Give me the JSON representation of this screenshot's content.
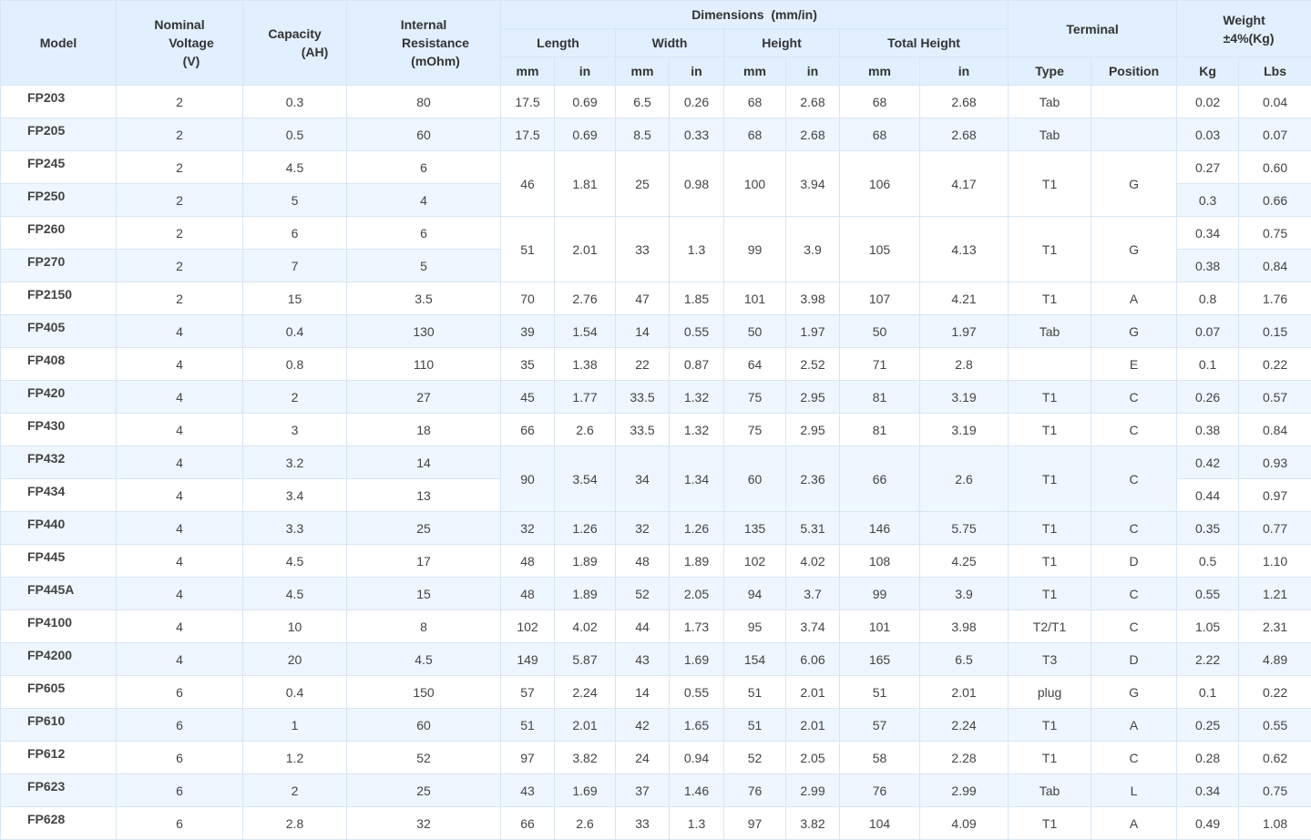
{
  "headers": {
    "model": "Model",
    "voltage": [
      "Nominal",
      "Voltage",
      "(V)"
    ],
    "capacity": [
      "Capacity",
      "(AH)"
    ],
    "resistance": [
      "Internal",
      "Resistance",
      "(mOhm)"
    ],
    "dimensions": "Dimensions  (mm/in)",
    "length": "Length",
    "width": "Width",
    "height": "Height",
    "total_height": "Total Height",
    "terminal": "Terminal",
    "weight": [
      "Weight",
      "±4%(Kg)"
    ],
    "mm": "mm",
    "in": "in",
    "type": "Type",
    "position": "Position",
    "kg": "Kg",
    "lbs": "Lbs"
  },
  "rows": [
    {
      "model": "FP203",
      "v": "2",
      "ah": "0.3",
      "r": "80",
      "dims": [
        "17.5",
        "0.69",
        "6.5",
        "0.26",
        "68",
        "2.68",
        "68",
        "2.68"
      ],
      "type": "Tab",
      "pos": "",
      "kg": "0.02",
      "lbs": "0.04"
    },
    {
      "model": "FP205",
      "v": "2",
      "ah": "0.5",
      "r": "60",
      "dims": [
        "17.5",
        "0.69",
        "8.5",
        "0.33",
        "68",
        "2.68",
        "68",
        "2.68"
      ],
      "type": "Tab",
      "pos": "",
      "kg": "0.03",
      "lbs": "0.07"
    },
    {
      "model": "FP245",
      "v": "2",
      "ah": "4.5",
      "r": "6",
      "dims": [
        "46",
        "1.81",
        "25",
        "0.98",
        "100",
        "3.94",
        "106",
        "4.17"
      ],
      "type": "T1",
      "pos": "G",
      "kg": "0.27",
      "lbs": "0.60"
    },
    {
      "model": "FP250",
      "v": "2",
      "ah": "5",
      "r": "4",
      "kg": "0.3",
      "lbs": "0.66"
    },
    {
      "model": "FP260",
      "v": "2",
      "ah": "6",
      "r": "6",
      "dims": [
        "51",
        "2.01",
        "33",
        "1.3",
        "99",
        "3.9",
        "105",
        "4.13"
      ],
      "type": "T1",
      "pos": "G",
      "kg": "0.34",
      "lbs": "0.75"
    },
    {
      "model": "FP270",
      "v": "2",
      "ah": "7",
      "r": "5",
      "kg": "0.38",
      "lbs": "0.84"
    },
    {
      "model": "FP2150",
      "v": "2",
      "ah": "15",
      "r": "3.5",
      "dims": [
        "70",
        "2.76",
        "47",
        "1.85",
        "101",
        "3.98",
        "107",
        "4.21"
      ],
      "type": "T1",
      "pos": "A",
      "kg": "0.8",
      "lbs": "1.76"
    },
    {
      "model": "FP405",
      "v": "4",
      "ah": "0.4",
      "r": "130",
      "dims": [
        "39",
        "1.54",
        "14",
        "0.55",
        "50",
        "1.97",
        "50",
        "1.97"
      ],
      "type": "Tab",
      "pos": "G",
      "kg": "0.07",
      "lbs": "0.15"
    },
    {
      "model": "FP408",
      "v": "4",
      "ah": "0.8",
      "r": "110",
      "dims": [
        "35",
        "1.38",
        "22",
        "0.87",
        "64",
        "2.52",
        "71",
        "2.8"
      ],
      "type": "",
      "pos": "E",
      "kg": "0.1",
      "lbs": "0.22"
    },
    {
      "model": "FP420",
      "v": "4",
      "ah": "2",
      "r": "27",
      "dims": [
        "45",
        "1.77",
        "33.5",
        "1.32",
        "75",
        "2.95",
        "81",
        "3.19"
      ],
      "type": "T1",
      "pos": "C",
      "kg": "0.26",
      "lbs": "0.57"
    },
    {
      "model": "FP430",
      "v": "4",
      "ah": "3",
      "r": "18",
      "dims": [
        "66",
        "2.6",
        "33.5",
        "1.32",
        "75",
        "2.95",
        "81",
        "3.19"
      ],
      "type": "T1",
      "pos": "C",
      "kg": "0.38",
      "lbs": "0.84"
    },
    {
      "model": "FP432",
      "v": "4",
      "ah": "3.2",
      "r": "14",
      "dims": [
        "90",
        "3.54",
        "34",
        "1.34",
        "60",
        "2.36",
        "66",
        "2.6"
      ],
      "type": "T1",
      "pos": "C",
      "kg": "0.42",
      "lbs": "0.93"
    },
    {
      "model": "FP434",
      "v": "4",
      "ah": "3.4",
      "r": "13",
      "kg": "0.44",
      "lbs": "0.97"
    },
    {
      "model": "FP440",
      "v": "4",
      "ah": "3.3",
      "r": "25",
      "dims": [
        "32",
        "1.26",
        "32",
        "1.26",
        "135",
        "5.31",
        "146",
        "5.75"
      ],
      "type": "T1",
      "pos": "C",
      "kg": "0.35",
      "lbs": "0.77"
    },
    {
      "model": "FP445",
      "v": "4",
      "ah": "4.5",
      "r": "17",
      "dims": [
        "48",
        "1.89",
        "48",
        "1.89",
        "102",
        "4.02",
        "108",
        "4.25"
      ],
      "type": "T1",
      "pos": "D",
      "kg": "0.5",
      "lbs": "1.10"
    },
    {
      "model": "FP445A",
      "v": "4",
      "ah": "4.5",
      "r": "15",
      "dims": [
        "48",
        "1.89",
        "52",
        "2.05",
        "94",
        "3.7",
        "99",
        "3.9"
      ],
      "type": "T1",
      "pos": "C",
      "kg": "0.55",
      "lbs": "1.21"
    },
    {
      "model": "FP4100",
      "v": "4",
      "ah": "10",
      "r": "8",
      "dims": [
        "102",
        "4.02",
        "44",
        "1.73",
        "95",
        "3.74",
        "101",
        "3.98"
      ],
      "type": "T2/T1",
      "pos": "C",
      "kg": "1.05",
      "lbs": "2.31"
    },
    {
      "model": "FP4200",
      "v": "4",
      "ah": "20",
      "r": "4.5",
      "dims": [
        "149",
        "5.87",
        "43",
        "1.69",
        "154",
        "6.06",
        "165",
        "6.5"
      ],
      "type": "T3",
      "pos": "D",
      "kg": "2.22",
      "lbs": "4.89"
    },
    {
      "model": "FP605",
      "v": "6",
      "ah": "0.4",
      "r": "150",
      "dims": [
        "57",
        "2.24",
        "14",
        "0.55",
        "51",
        "2.01",
        "51",
        "2.01"
      ],
      "type": "plug",
      "pos": "G",
      "kg": "0.1",
      "lbs": "0.22"
    },
    {
      "model": "FP610",
      "v": "6",
      "ah": "1",
      "r": "60",
      "dims": [
        "51",
        "2.01",
        "42",
        "1.65",
        "51",
        "2.01",
        "57",
        "2.24"
      ],
      "type": "T1",
      "pos": "A",
      "kg": "0.25",
      "lbs": "0.55"
    },
    {
      "model": "FP612",
      "v": "6",
      "ah": "1.2",
      "r": "52",
      "dims": [
        "97",
        "3.82",
        "24",
        "0.94",
        "52",
        "2.05",
        "58",
        "2.28"
      ],
      "type": "T1",
      "pos": "C",
      "kg": "0.28",
      "lbs": "0.62"
    },
    {
      "model": "FP623",
      "v": "6",
      "ah": "2",
      "r": "25",
      "dims": [
        "43",
        "1.69",
        "37",
        "1.46",
        "76",
        "2.99",
        "76",
        "2.99"
      ],
      "type": "Tab",
      "pos": "L",
      "kg": "0.34",
      "lbs": "0.75"
    },
    {
      "model": "FP628",
      "v": "6",
      "ah": "2.8",
      "r": "32",
      "dims": [
        "66",
        "2.6",
        "33",
        "1.3",
        "97",
        "3.82",
        "104",
        "4.09"
      ],
      "type": "T1",
      "pos": "A",
      "kg": "0.49",
      "lbs": "1.08"
    }
  ]
}
